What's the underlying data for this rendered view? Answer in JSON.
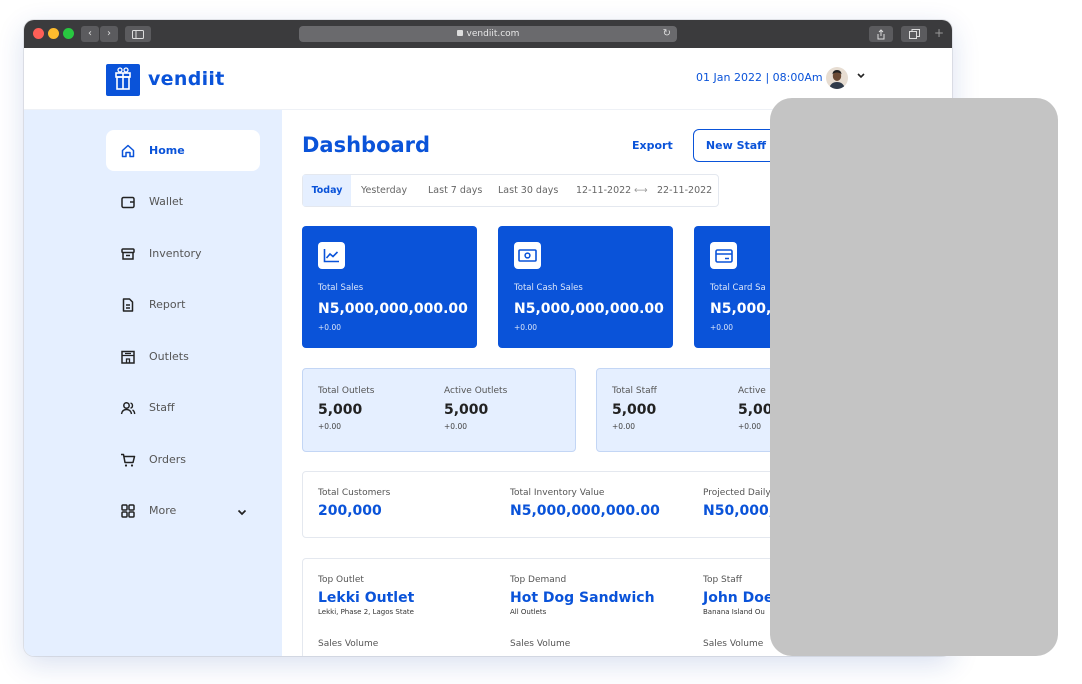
{
  "browser": {
    "url": "vendiit.com",
    "nav_back": "‹",
    "nav_forward": "›",
    "new_tab": "+"
  },
  "header": {
    "brand": "vendiit",
    "datetime": "01 Jan 2022 | 08:00Am"
  },
  "sidebar": {
    "items": [
      {
        "label": "Home",
        "icon": "home-icon",
        "active": true
      },
      {
        "label": "Wallet",
        "icon": "wallet-icon"
      },
      {
        "label": "Inventory",
        "icon": "inventory-box-icon"
      },
      {
        "label": "Report",
        "icon": "report-document-icon"
      },
      {
        "label": "Outlets",
        "icon": "store-icon"
      },
      {
        "label": "Staff",
        "icon": "staff-people-icon"
      },
      {
        "label": "Orders",
        "icon": "cart-icon"
      },
      {
        "label": "More",
        "icon": "grid-icon"
      }
    ]
  },
  "dashboard": {
    "title": "Dashboard",
    "export_label": "Export",
    "new_staff_label": "New Staff"
  },
  "filters": {
    "today": "Today",
    "yesterday": "Yesterday",
    "last7": "Last 7 days",
    "last30": "Last 30 days",
    "range_start": "12-11-2022",
    "range_end": "22-11-2022",
    "range_arrow": "⟷",
    "active": "Today"
  },
  "sales_cards": [
    {
      "title": "Total Sales",
      "value": "N5,000,000,000.00",
      "delta": "+0.00"
    },
    {
      "title": "Total Cash Sales",
      "value": "N5,000,000,000.00",
      "delta": "+0.00"
    },
    {
      "title": "Total Card Sa",
      "value": "N5,000,0",
      "delta": "+0.00"
    }
  ],
  "outlet_stats": [
    {
      "title": "Total Outlets",
      "value": "5,000",
      "delta": "+0.00"
    },
    {
      "title": "Active Outlets",
      "value": "5,000",
      "delta": "+0.00"
    }
  ],
  "staff_stats": [
    {
      "title": "Total Staff",
      "value": "5,000",
      "delta": "+0.00"
    },
    {
      "title": "Active",
      "value": "5,00",
      "delta": "+0.00"
    }
  ],
  "summary": [
    {
      "title": "Total Customers",
      "value": "200,000"
    },
    {
      "title": "Total Inventory Value",
      "value": "N5,000,000,000.00"
    },
    {
      "title": "Projected Daily",
      "value": "N50,000,0"
    }
  ],
  "tops": [
    {
      "title": "Top Outlet",
      "value": "Lekki Outlet",
      "sub": "Lekki, Phase 2, Lagos State",
      "volume_label": "Sales Volume"
    },
    {
      "title": "Top Demand",
      "value": "Hot Dog Sandwich",
      "sub": "All Outlets",
      "volume_label": "Sales Volume"
    },
    {
      "title": "Top Staff",
      "value": "John Doe",
      "sub": "Banana Island Ou",
      "volume_label": "Sales Volume"
    }
  ],
  "colors": {
    "accent": "#0a53d9",
    "sidebar_bg": "#e5efff",
    "overlay": "#c4c4c4"
  }
}
